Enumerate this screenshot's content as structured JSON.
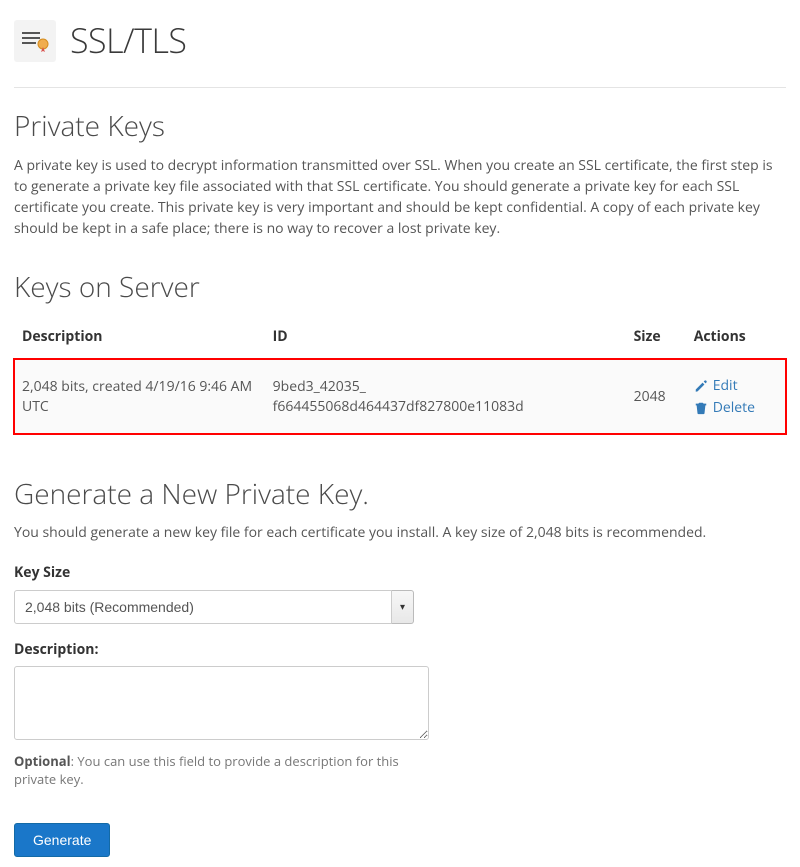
{
  "header": {
    "title": "SSL/TLS"
  },
  "section_private_keys": {
    "heading": "Private Keys",
    "intro": "A private key is used to decrypt information transmitted over SSL. When you create an SSL certificate, the first step is to generate a private key file associated with that SSL certificate. You should generate a private key for each SSL certificate you create. This private key is very important and should be kept confidential. A copy of each private key should be kept in a safe place; there is no way to recover a lost private key."
  },
  "section_keys_on_server": {
    "heading": "Keys on Server",
    "columns": {
      "description": "Description",
      "id": "ID",
      "size": "Size",
      "actions": "Actions"
    },
    "rows": [
      {
        "description": "2,048 bits, created 4/19/16 9:46 AM UTC",
        "id_line1": "9bed3_42035_",
        "id_line2": "f664455068d464437df827800e11083d",
        "size": "2048",
        "actions": {
          "edit": "Edit",
          "delete": "Delete"
        }
      }
    ]
  },
  "section_generate": {
    "heading": "Generate a New Private Key.",
    "help": "You should generate a new key file for each certificate you install. A key size of 2,048 bits is recommended.",
    "key_size": {
      "label": "Key Size",
      "selected": "2,048 bits (Recommended)"
    },
    "description": {
      "label": "Description:",
      "hint_bold": "Optional",
      "hint_rest": ": You can use this field to provide a description for this private key."
    },
    "submit": "Generate"
  }
}
